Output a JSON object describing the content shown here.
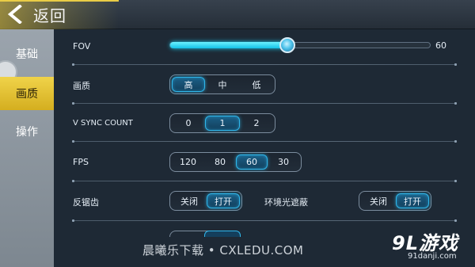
{
  "header": {
    "back_label": "返回"
  },
  "sidebar": {
    "items": [
      {
        "label": "基础",
        "active": false
      },
      {
        "label": "画质",
        "active": true
      },
      {
        "label": "操作",
        "active": false
      }
    ]
  },
  "settings": {
    "fov": {
      "label": "FOV",
      "value": "60",
      "fraction": 0.45
    },
    "quality": {
      "label": "画质",
      "options": [
        "高",
        "中",
        "低"
      ],
      "selected": "高"
    },
    "vsync": {
      "label": "V SYNC COUNT",
      "options": [
        "0",
        "1",
        "2"
      ],
      "selected": "1"
    },
    "fps": {
      "label": "FPS",
      "options": [
        "120",
        "80",
        "60",
        "30"
      ],
      "selected": "60"
    },
    "antialias": {
      "label": "反锯齿",
      "options": [
        "关闭",
        "打开"
      ],
      "selected": "打开"
    },
    "ambient_occlusion": {
      "label": "环境光遮蔽",
      "options": [
        "关闭",
        "打开"
      ],
      "selected": "打开"
    }
  },
  "watermark": {
    "text": "晨曦乐下载 • CXLEDU.COM",
    "logo_main": "9L游戏",
    "logo_sub": "91danji.com"
  },
  "colors": {
    "accent_cyan": "#1ad0f0",
    "active_tab_yellow": "#e9cc46"
  }
}
